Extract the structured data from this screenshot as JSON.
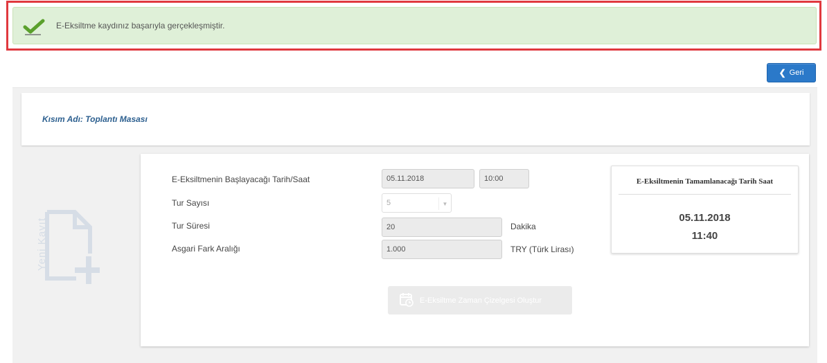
{
  "alert": {
    "message": "E-Eksiltme kaydınız başarıyla gerçekleşmiştir.",
    "icon": "check-icon",
    "success_color": "#dff0d8",
    "highlight_color": "#e0383e"
  },
  "toolbar": {
    "back_label": "Geri",
    "back_icon": "chevron-left-icon",
    "back_color": "#2b79c9"
  },
  "section": {
    "title": "Kısım Adı: Toplantı Masası"
  },
  "new_record": {
    "label": "Yeni Kayıt",
    "icon": "new-document-icon"
  },
  "form": {
    "start_label": "E-Eksiltmenin Başlayacağı Tarih/Saat",
    "start_date": "05.11.2018",
    "start_time": "10:00",
    "rounds_label": "Tur Sayısı",
    "rounds_value": "5",
    "duration_label": "Tur Süresi",
    "duration_value": "20",
    "duration_unit": "Dakika",
    "min_diff_label": "Asgari Fark Aralığı",
    "min_diff_value": "1.000",
    "min_diff_unit": "TRY (Türk Lirası)"
  },
  "result": {
    "title": "E-Eksiltmenin Tamamlanacağı Tarih Saat",
    "date": "05.11.2018",
    "time": "11:40"
  },
  "create_button": {
    "label": "E-Eksiltme Zaman Çizelgesi Oluştur",
    "icon": "calendar-icon"
  }
}
